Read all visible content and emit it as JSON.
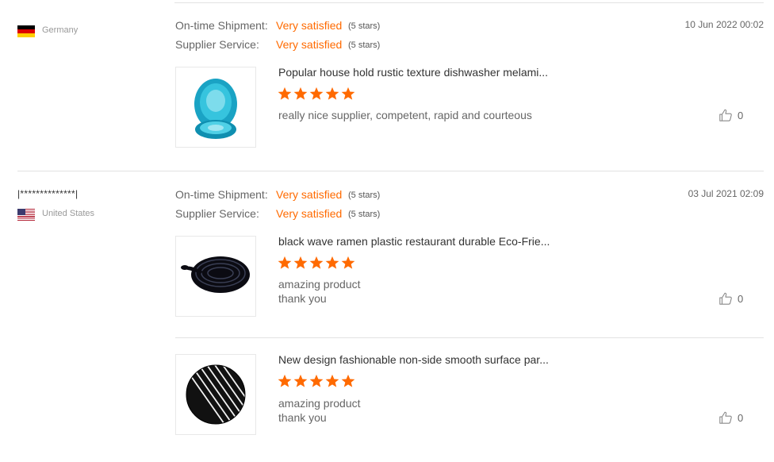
{
  "reviews": [
    {
      "buyer": "",
      "country": "Germany",
      "flag": "germany-flag",
      "shipment_label": "On-time Shipment:",
      "shipment_value": "Very satisfied",
      "shipment_stars": "(5 stars)",
      "service_label": "Supplier Service:",
      "service_value": "Very satisfied",
      "service_stars": "(5 stars)",
      "date": "10 Jun 2022 00:02",
      "products": [
        {
          "name": "Popular house hold rustic texture dishwasher melami...",
          "rating": 5,
          "comment_lines": [
            "really nice supplier, competent, rapid and courteous"
          ],
          "likes": "0"
        }
      ]
    },
    {
      "buyer": "|**************|",
      "country": "United States",
      "flag": "usa-flag",
      "shipment_label": "On-time Shipment:",
      "shipment_value": "Very satisfied",
      "shipment_stars": "(5 stars)",
      "service_label": "Supplier Service:",
      "service_value": "Very satisfied",
      "service_stars": "(5 stars)",
      "date": "03 Jul 2021 02:09",
      "products": [
        {
          "name": "black wave ramen plastic restaurant durable Eco-Frie...",
          "rating": 5,
          "comment_lines": [
            "amazing product",
            "thank you"
          ],
          "likes": "0"
        },
        {
          "name": "New design fashionable non-side smooth surface par...",
          "rating": 5,
          "comment_lines": [
            "amazing product",
            "thank you"
          ],
          "likes": "0"
        }
      ]
    }
  ],
  "colors": {
    "accent": "#ff6a00",
    "star": "#ff6a00",
    "divider": "#e2e2e2"
  }
}
